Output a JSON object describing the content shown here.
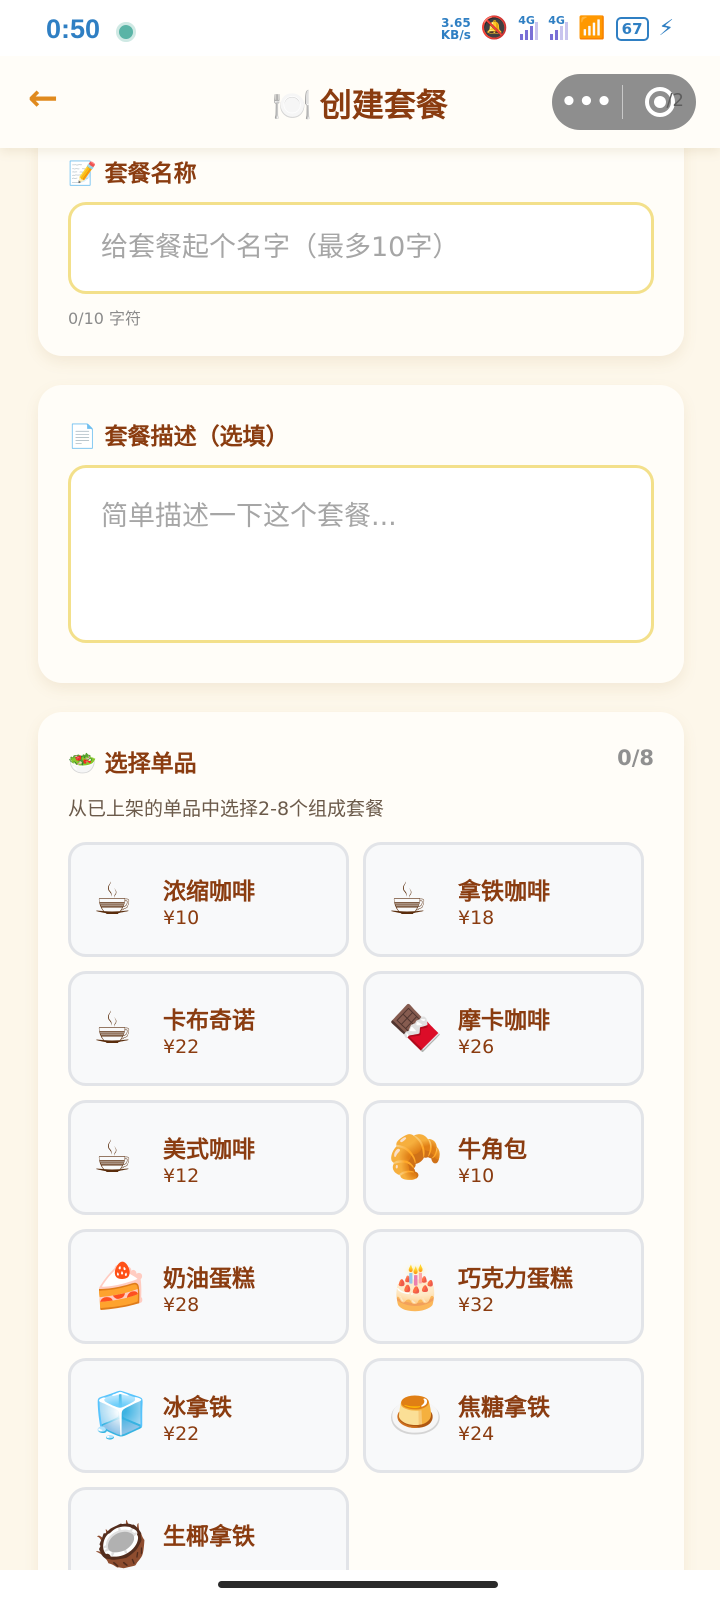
{
  "status_bar": {
    "time": "0:50",
    "net_speed_value": "3.65",
    "net_speed_unit": "KB/s",
    "signal_1_label": "4G",
    "signal_2_label": "4G",
    "battery": "67",
    "icons": [
      "notification-dot-icon",
      "mute-bell-icon",
      "wifi-icon",
      "charging-icon"
    ]
  },
  "header": {
    "back_icon": "←",
    "title_emoji": "🍽️",
    "title": "创建套餐",
    "menu_dots": "•••",
    "page_indicator": "/2"
  },
  "name_section": {
    "icon": "📝",
    "title": "套餐名称",
    "placeholder": "给套餐起个名字（最多10字）",
    "char_count": "0/10 字符"
  },
  "desc_section": {
    "icon": "📄",
    "title": "套餐描述（选填）",
    "placeholder": "简单描述一下这个套餐..."
  },
  "items_section": {
    "icon": "🥗",
    "title": "选择单品",
    "count": "0/8",
    "subtitle": "从已上架的单品中选择2-8个组成套餐",
    "items": [
      {
        "emoji": "☕",
        "name": "浓缩咖啡",
        "price": "¥10"
      },
      {
        "emoji": "☕",
        "name": "拿铁咖啡",
        "price": "¥18"
      },
      {
        "emoji": "☕",
        "name": "卡布奇诺",
        "price": "¥22"
      },
      {
        "emoji": "🍫",
        "name": "摩卡咖啡",
        "price": "¥26"
      },
      {
        "emoji": "☕",
        "name": "美式咖啡",
        "price": "¥12"
      },
      {
        "emoji": "🥐",
        "name": "牛角包",
        "price": "¥10"
      },
      {
        "emoji": "🍰",
        "name": "奶油蛋糕",
        "price": "¥28"
      },
      {
        "emoji": "🎂",
        "name": "巧克力蛋糕",
        "price": "¥32"
      },
      {
        "emoji": "🧊",
        "name": "冰拿铁",
        "price": "¥22"
      },
      {
        "emoji": "🍮",
        "name": "焦糖拿铁",
        "price": "¥24"
      },
      {
        "emoji": "🥥",
        "name": "生椰拿铁",
        "price": ""
      }
    ]
  }
}
